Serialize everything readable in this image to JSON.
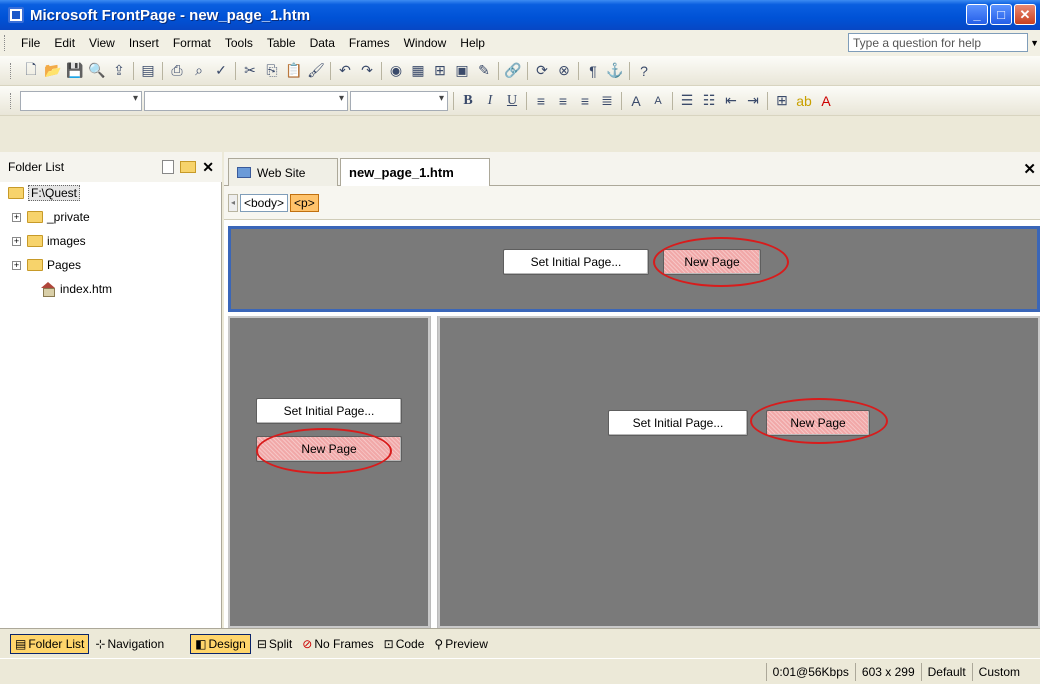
{
  "window": {
    "title": "Microsoft FrontPage - new_page_1.htm",
    "controls": [
      "minimize",
      "maximize",
      "close"
    ]
  },
  "menu": {
    "items": [
      "File",
      "Edit",
      "View",
      "Insert",
      "Format",
      "Tools",
      "Table",
      "Data",
      "Frames",
      "Window",
      "Help"
    ],
    "help_placeholder": "Type a question for help"
  },
  "folder_list": {
    "title": "Folder List",
    "root": "F:\\Quest",
    "items": [
      {
        "label": "_private",
        "type": "folder"
      },
      {
        "label": "images",
        "type": "folder"
      },
      {
        "label": "Pages",
        "type": "folder"
      },
      {
        "label": "index.htm",
        "type": "home-page"
      }
    ]
  },
  "doc_tabs": {
    "web_site": "Web Site",
    "page": "new_page_1.htm"
  },
  "tag_selector": {
    "tags": [
      "<body>",
      "<p>"
    ],
    "selected": "<p>"
  },
  "frames": {
    "top": {
      "set_initial": "Set Initial Page...",
      "new_page": "New Page"
    },
    "left": {
      "set_initial": "Set Initial Page...",
      "new_page": "New Page"
    },
    "right": {
      "set_initial": "Set Initial Page...",
      "new_page": "New Page"
    }
  },
  "left_pane_tabs": {
    "folder_list": "Folder List",
    "navigation": "Navigation"
  },
  "view_tabs": [
    {
      "label": "Design",
      "active": true
    },
    {
      "label": "Split",
      "active": false
    },
    {
      "label": "No Frames",
      "active": false
    },
    {
      "label": "Code",
      "active": false
    },
    {
      "label": "Preview",
      "active": false
    }
  ],
  "status": {
    "download": "0:01@56Kbps",
    "size": "603 x 299",
    "style": "Default",
    "mode": "Custom"
  },
  "colors": {
    "title_bar": "#0052d6",
    "frame_bg": "#7a7a7a",
    "highlight_ring": "#d81c1c",
    "selected_frame_border": "#3a66b8"
  }
}
